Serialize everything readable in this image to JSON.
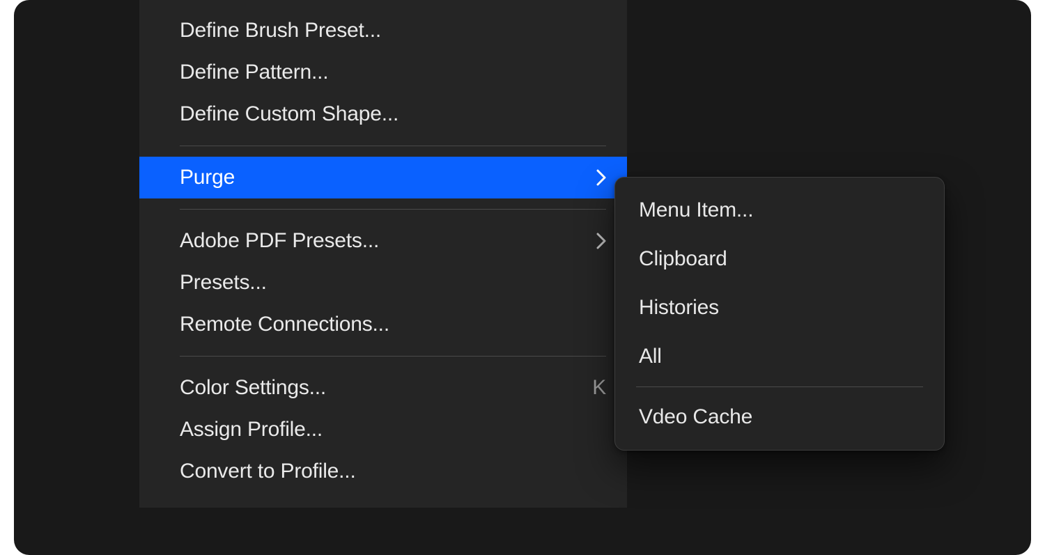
{
  "mainMenu": {
    "items": [
      {
        "label": "Define Brush Preset...",
        "selected": false
      },
      {
        "label": "Define Pattern...",
        "selected": false
      },
      {
        "label": "Define Custom Shape...",
        "selected": false
      },
      {
        "separator": true
      },
      {
        "label": "Purge",
        "selected": true,
        "hasSubmenu": true
      },
      {
        "separator": true
      },
      {
        "label": "Adobe PDF Presets...",
        "hasSubmenu": true
      },
      {
        "label": "Presets..."
      },
      {
        "label": "Remote Connections..."
      },
      {
        "separator": true
      },
      {
        "label": "Color Settings...",
        "shortcut": "K"
      },
      {
        "label": "Assign Profile..."
      },
      {
        "label": "Convert to Profile..."
      }
    ]
  },
  "submenu": {
    "items": [
      {
        "label": "Menu Item..."
      },
      {
        "label": "Clipboard"
      },
      {
        "label": "Histories"
      },
      {
        "label": "All"
      },
      {
        "separator": true
      },
      {
        "label": "Vdeo Cache"
      }
    ]
  },
  "colors": {
    "selection": "#0a61ff",
    "menuBg": "#252525",
    "stageBg": "#191919"
  }
}
